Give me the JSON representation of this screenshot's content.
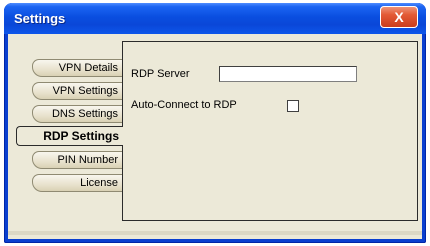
{
  "window": {
    "title": "Settings",
    "close_label": "X"
  },
  "tabs": [
    {
      "label": "VPN Details"
    },
    {
      "label": "VPN Settings"
    },
    {
      "label": "DNS Settings"
    },
    {
      "label": "RDP Settings",
      "active": true
    },
    {
      "label": "PIN Number"
    },
    {
      "label": "License"
    }
  ],
  "rdp_panel": {
    "server_label": "RDP Server",
    "server_value": "",
    "auto_connect_label": "Auto-Connect to RDP",
    "auto_connect_checked": false
  }
}
